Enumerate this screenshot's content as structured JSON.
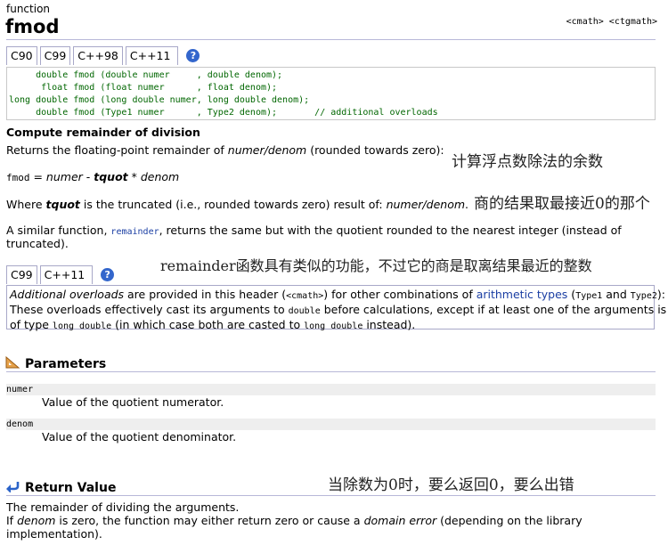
{
  "header": {
    "kind": "function",
    "name": "fmod",
    "headers": "<cmath> <ctgmath>"
  },
  "tabs_top": [
    "C90",
    "C99",
    "C++98",
    "C++11"
  ],
  "help_glyph": "?",
  "code_lines": [
    "     double fmod (double numer     , double denom);",
    "      float fmod (float numer      , float denom);",
    "long double fmod (long double numer, long double denom);",
    "     double fmod (Type1 numer      , Type2 denom);       // additional overloads"
  ],
  "summary_title": "Compute remainder of division",
  "returns_line": {
    "before": "Returns the floating-point remainder of ",
    "em": "numer/denom",
    "after": " (rounded towards zero):"
  },
  "formula": {
    "code": "fmod",
    "eq": " = ",
    "numer": "numer",
    "minus": " - ",
    "tquot": "tquot",
    "times": " * ",
    "denom": "denom"
  },
  "where_line": {
    "a": "Where ",
    "tquot": "tquot",
    "b": " is the truncated (i.e., rounded towards zero) result of: ",
    "em": "numer/denom",
    "c": "."
  },
  "similar": {
    "a": "A similar function, ",
    "code": "remainder",
    "b": ", returns the same but with the quotient rounded to the nearest integer (instead of",
    "c": "truncated)."
  },
  "tabs_mid": [
    "C99",
    "C++11"
  ],
  "additional": {
    "em": "Additional overloads",
    "a": " are provided in this header (",
    "code1": "<cmath>",
    "b": ") for other combinations of ",
    "link": "arithmetic types",
    "c": " (",
    "code2": "Type1",
    "d": " and ",
    "code3": "Type2",
    "e": "):",
    "line2a": "These overloads effectively cast its arguments to ",
    "code4": "double",
    "line2b": " before calculations, except if at least one of the arguments is",
    "line3a": "of type ",
    "code5": "long double",
    "line3b": " (in which case both are casted to ",
    "code6": "long double",
    "line3c": " instead)."
  },
  "parameters": {
    "title": "Parameters",
    "items": [
      {
        "name": "numer",
        "desc": "Value of the quotient numerator."
      },
      {
        "name": "denom",
        "desc": "Value of the quotient denominator."
      }
    ]
  },
  "return_value": {
    "title": "Return Value",
    "line1": "The remainder of dividing the arguments.",
    "line2a": "If ",
    "line2em": "denom",
    "line2b": " is zero, the function may either return zero or cause a ",
    "line2em2": "domain error",
    "line2c": " (depending on the library",
    "line3": "implementation)."
  },
  "annotations": {
    "a1": "计算浮点数除法的余数",
    "a2": "商的结果取最接近0的那个",
    "a3": "remainder函数具有类似的功能，不过它的商是取离结果最近的整数",
    "a4": "当除数为0时，要么返回0，要么出错"
  },
  "colors": {
    "code_green": "#006600",
    "tab_border": "#a8a8c8",
    "help_blue": "#3366cc",
    "link_blue": "#1a3ea3",
    "param_bg": "#eeeeee"
  }
}
